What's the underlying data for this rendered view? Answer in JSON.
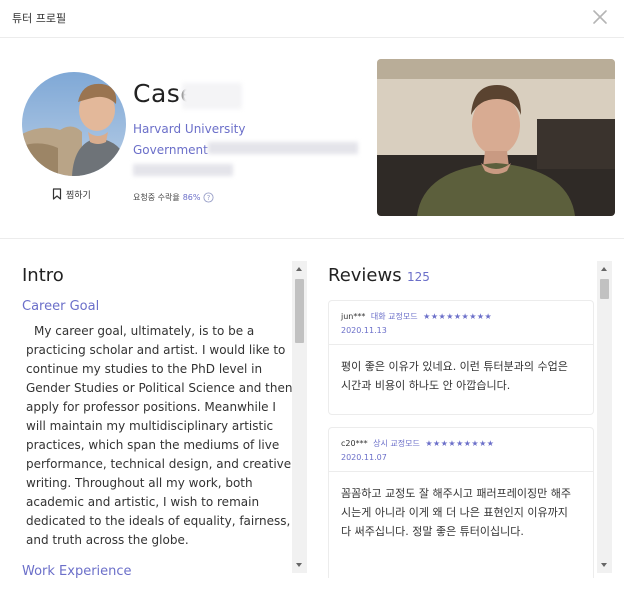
{
  "modal": {
    "title": "튜터 프로필",
    "close_icon": "close-icon"
  },
  "profile": {
    "name": "Case",
    "university": "Harvard University",
    "department": "Government",
    "bookmark_label": "찜하기",
    "accept_rate_label": "요청중 수락율",
    "accept_rate_value": "86%",
    "help_icon": "question-circle-icon",
    "bookmark_icon": "bookmark-icon",
    "video_icon": "tutor-intro-video"
  },
  "intro": {
    "title": "Intro",
    "career_goal_heading": "Career Goal",
    "career_goal_text": "My career goal, ultimately, is to be a practicing scholar and artist. I would like to continue my studies to the PhD level in Gender Studies or Political Science and then apply for professor positions. Meanwhile I will maintain my multidisciplinary artistic practices, which span the mediums of live performance, technical design, and creative writing. Throughout all my work, both academic and artistic, I wish to remain dedicated to the ideals of equality, fairness, and truth across the globe.",
    "work_experience_heading": "Work Experience"
  },
  "reviews": {
    "title": "Reviews",
    "count": "125",
    "items": [
      {
        "reviewer": "jun***",
        "mode": "대화 교정모드",
        "stars": "★★★★★★★★★",
        "date": "2020.11.13",
        "text": "평이 좋은 이유가 있네요. 이런 튜터분과의 수업은 시간과 비용이 하나도 안 아깝습니다."
      },
      {
        "reviewer": "c20***",
        "mode": "상시 교정모드",
        "stars": "★★★★★★★★★",
        "date": "2020.11.07",
        "text": "꼼꼼하고 교정도 잘 해주시고 패러프레이징만 해주시는게 아니라 이게 왜 더 나은 표현인지 이유까지 다 써주십니다. 정말 좋은 튜터이십니다."
      }
    ]
  },
  "colors": {
    "accent": "#6b6fc9",
    "divider": "#ececec"
  }
}
